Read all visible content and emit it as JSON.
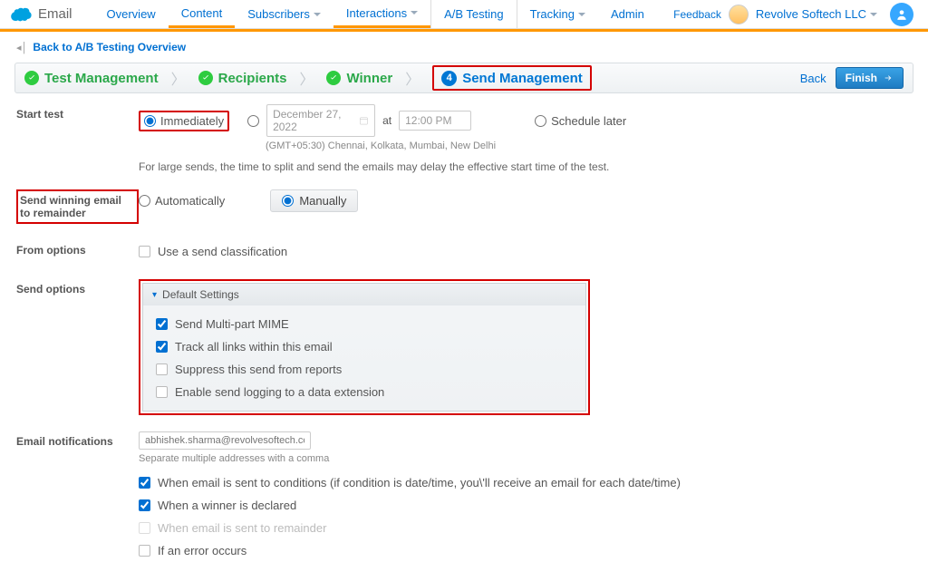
{
  "header": {
    "app": "Email",
    "nav": [
      "Overview",
      "Content",
      "Subscribers",
      "Interactions",
      "A/B Testing",
      "Tracking",
      "Admin"
    ],
    "feedback": "Feedback",
    "company": "Revolve Softech LLC"
  },
  "backlink": "Back to A/B Testing Overview",
  "steps": {
    "s1": "Test Management",
    "s2": "Recipients",
    "s3": "Winner",
    "s4_num": "4",
    "s4": "Send Management",
    "back": "Back",
    "finish": "Finish"
  },
  "start_test": {
    "label": "Start test",
    "immediately": "Immediately",
    "date": "December 27, 2022",
    "at": "at",
    "time": "12:00 PM",
    "schedule_later": "Schedule later",
    "tz": "(GMT+05:30) Chennai, Kolkata, Mumbai, New Delhi",
    "note": "For large sends, the time to split and send the emails may delay the effective start time of the test."
  },
  "winning": {
    "label": "Send winning email to remainder",
    "auto": "Automatically",
    "manual": "Manually"
  },
  "from_opts": {
    "label": "From options",
    "chk": "Use a send classification"
  },
  "send_opts": {
    "label": "Send options",
    "panel_title": "Default Settings",
    "mime": "Send Multi-part MIME",
    "track": "Track all links within this email",
    "suppress": "Suppress this send from reports",
    "logging": "Enable send logging to a data extension"
  },
  "notifs": {
    "label": "Email notifications",
    "placeholder": "abhishek.sharma@revolvesoftech.com",
    "sub": "Separate multiple addresses with a comma",
    "c1": "When email is sent to conditions (if condition is date/time, you\\'ll receive an email for each date/time)",
    "c2": "When a winner is declared",
    "c3": "When email is sent to remainder",
    "c4": "If an error occurs"
  }
}
